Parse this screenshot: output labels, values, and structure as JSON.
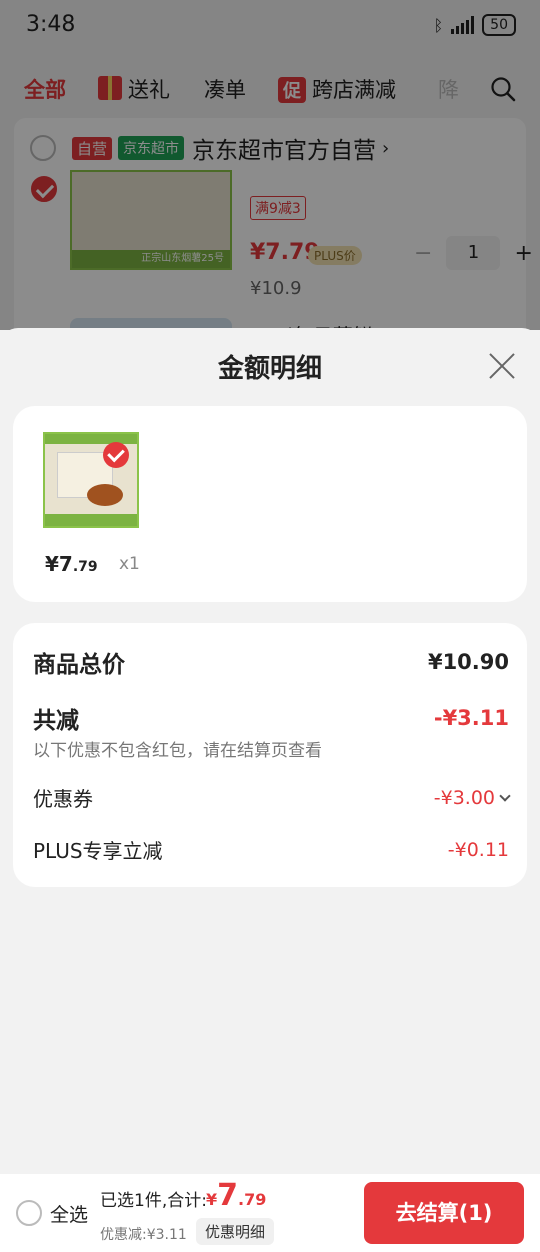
{
  "status_bar": {
    "time": "3:48",
    "battery": "50"
  },
  "tabs": [
    {
      "label": "全部"
    },
    {
      "label": "送礼"
    },
    {
      "label": "凑单"
    },
    {
      "badge": "促",
      "label": "跨店满减"
    },
    {
      "label": "降"
    }
  ],
  "cart": {
    "shop": {
      "tag_self": "自营",
      "tag_super": "京东超市",
      "name": "京东超市官方自营"
    },
    "item": {
      "image_text": "正宗山东烟薯25号",
      "discount_tag": "满9减3",
      "price": "¥7.79",
      "plus_tag": "PLUS价",
      "qty": "1",
      "minus": "−",
      "plus": "+",
      "orig_price": "¥10.9"
    },
    "next_title": "M…l每日蔬鲜…"
  },
  "sheet": {
    "title": "金额明细",
    "item": {
      "price_int": "¥7",
      "price_dec": ".79",
      "qty": "x1"
    },
    "rows": {
      "total_label": "商品总价",
      "total_value": "¥10.90",
      "reduce_label": "共减",
      "reduce_value": "-¥3.11",
      "note": "以下优惠不包含红包，请在结算页查看",
      "coupon_label": "优惠券",
      "coupon_value": "-¥3.00",
      "plus_label": "PLUS专享立减",
      "plus_value": "-¥0.11"
    }
  },
  "bottom": {
    "select_all": "全选",
    "selected_text": "已选1件,合计:",
    "total_cur": "¥",
    "total_int": "7",
    "total_dec": ".79",
    "discount_text": "优惠减:¥3.11",
    "detail_label": "优惠明细",
    "settle_label": "去结算(1)"
  },
  "colors": {
    "accent": "#e4393c",
    "green": "#1fa356",
    "bg": "#f2f2f2"
  }
}
